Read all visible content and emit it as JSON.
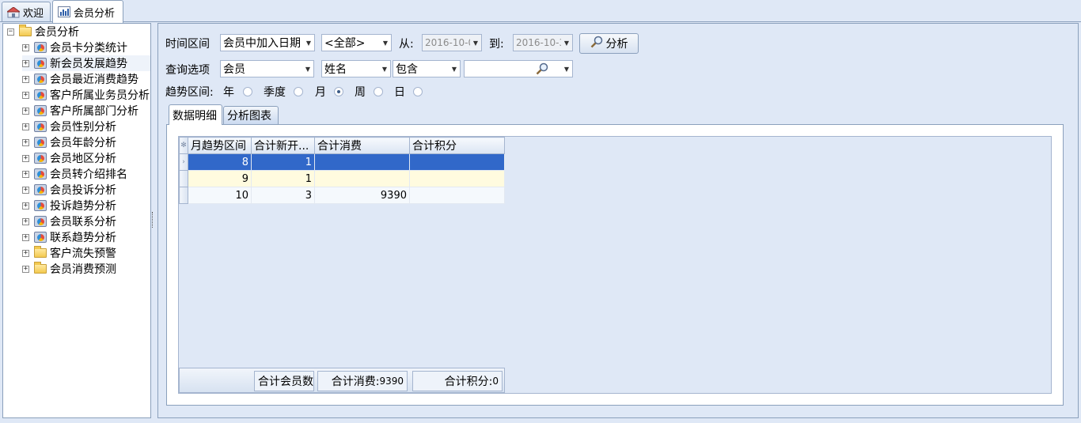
{
  "tabs": [
    {
      "label": "欢迎"
    },
    {
      "label": "会员分析"
    }
  ],
  "tree": {
    "root": "会员分析",
    "items": [
      {
        "label": "会员卡分类统计",
        "type": "chart"
      },
      {
        "label": "新会员发展趋势",
        "type": "chart"
      },
      {
        "label": "会员最近消费趋势",
        "type": "chart"
      },
      {
        "label": "客户所属业务员分析",
        "type": "chart"
      },
      {
        "label": "客户所属部门分析",
        "type": "chart"
      },
      {
        "label": "会员性别分析",
        "type": "chart"
      },
      {
        "label": "会员年龄分析",
        "type": "chart"
      },
      {
        "label": "会员地区分析",
        "type": "chart"
      },
      {
        "label": "会员转介绍排名",
        "type": "chart"
      },
      {
        "label": "会员投诉分析",
        "type": "chart"
      },
      {
        "label": "投诉趋势分析",
        "type": "chart"
      },
      {
        "label": "会员联系分析",
        "type": "chart"
      },
      {
        "label": "联系趋势分析",
        "type": "chart"
      },
      {
        "label": "客户流失预警",
        "type": "folder"
      },
      {
        "label": "会员消费预测",
        "type": "folder"
      }
    ]
  },
  "filters": {
    "time_label": "时间区间",
    "time_field": "会员中加入日期",
    "time_range": "<全部>",
    "from_label": "从:",
    "from_value": "2016-10-0",
    "to_label": "到:",
    "to_value": "2016-10-3",
    "analyze_button": "分析",
    "query_label": "查询选项",
    "query_target": "会员",
    "query_field": "姓名",
    "query_op": "包含",
    "query_value": "",
    "trend_label": "趋势区间:",
    "trend_options": [
      "年",
      "季度",
      "月",
      "周",
      "日"
    ],
    "trend_selected": "月"
  },
  "sub_tabs": [
    "数据明细",
    "分析图表"
  ],
  "grid": {
    "columns": [
      "月趋势区间",
      "合计新开...",
      "合计消费",
      "合计积分"
    ],
    "rows": [
      [
        "8",
        "1",
        "",
        ""
      ],
      [
        "9",
        "1",
        "",
        ""
      ],
      [
        "10",
        "3",
        "9390",
        ""
      ]
    ],
    "footer": {
      "members_label": "合计会员数",
      "consume_label": "合计消费:",
      "consume_value": "9390",
      "points_label": "合计积分:",
      "points_value": "0"
    }
  }
}
